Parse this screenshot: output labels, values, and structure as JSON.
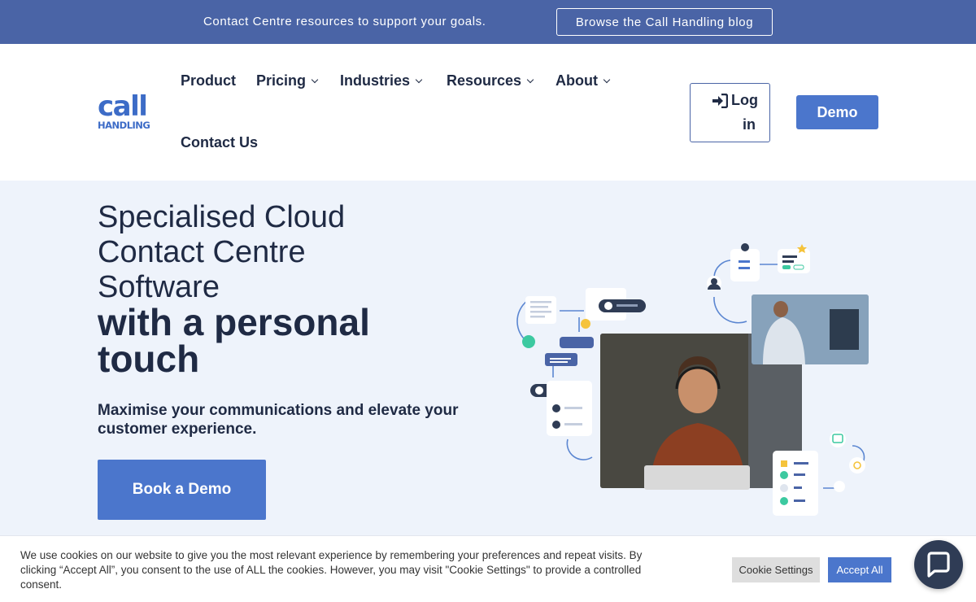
{
  "promo": {
    "text": "Contact Centre resources to support your goals.",
    "button_label": "Browse the Call Handling blog"
  },
  "logo": {
    "line1": "call",
    "line2": "HANDLING"
  },
  "nav": {
    "items": [
      {
        "label": "Product"
      },
      {
        "label": "Pricing"
      },
      {
        "label": "Industries"
      },
      {
        "label": "Resources"
      },
      {
        "label": "About"
      },
      {
        "label": "Contact Us"
      }
    ],
    "login_line1": "Log",
    "login_line2": "in",
    "demo_label": "Demo"
  },
  "hero": {
    "light_lines": [
      "Specialised Cloud",
      "Contact Centre",
      "Software"
    ],
    "bold_lines": [
      "with a personal",
      "touch"
    ],
    "subtitle": "Maximise your communications and elevate your customer experience.",
    "cta_label": "Book a Demo"
  },
  "cookie": {
    "text": "We use cookies on our website to give you the most relevant experience by remembering your preferences and repeat visits. By clicking “Accept All”, you consent to the use of ALL the cookies. However, you may visit \"Cookie Settings\" to provide a controlled consent.",
    "settings_label": "Cookie Settings",
    "accept_label": "Accept All"
  },
  "colors": {
    "promo_bg": "#4a64a6",
    "accent": "#4b76cc",
    "text_dark": "#1f2a44",
    "hero_bg": "#eef3fb",
    "teal": "#3cc9a0",
    "amber": "#f5c33b"
  },
  "icons": {
    "login": "login-arrow-icon",
    "chat": "chat-bubble-icon",
    "chevron": "chevron-down-icon"
  }
}
